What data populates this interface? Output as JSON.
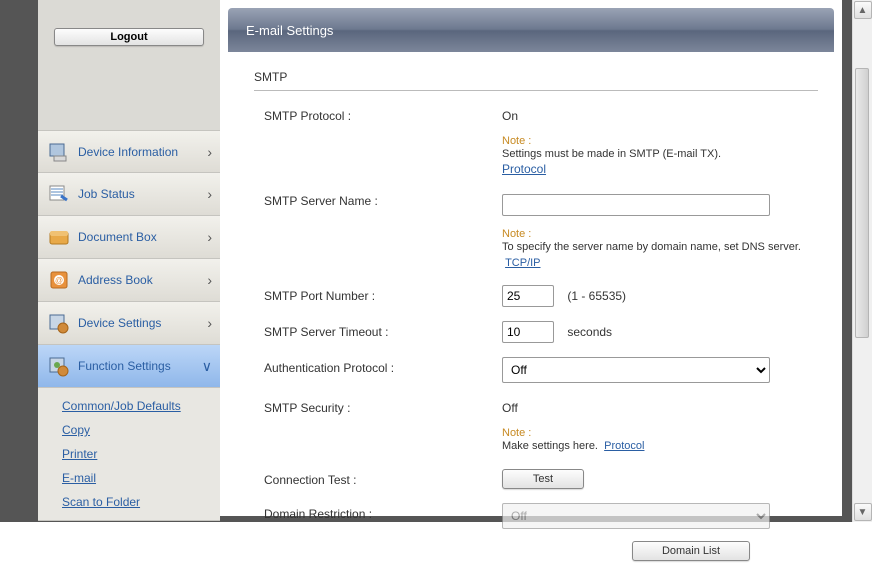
{
  "sidebar": {
    "logout_label": "Logout",
    "items": [
      {
        "label": "Device Information"
      },
      {
        "label": "Job Status"
      },
      {
        "label": "Document Box"
      },
      {
        "label": "Address Book"
      },
      {
        "label": "Device Settings"
      },
      {
        "label": "Function Settings"
      }
    ],
    "sub_items": [
      "Common/Job Defaults",
      "Copy",
      "Printer",
      "E-mail",
      "Scan to Folder"
    ]
  },
  "main": {
    "title": "E-mail Settings",
    "section": "SMTP",
    "rows": {
      "smtp_protocol_label": "SMTP Protocol :",
      "smtp_protocol_value": "On",
      "note1_title": "Note :",
      "note1_body": "Settings must be made in SMTP (E-mail TX).",
      "note1_link": "Protocol",
      "smtp_server_name_label": "SMTP Server Name :",
      "smtp_server_name_value": "",
      "note2_title": "Note :",
      "note2_body": "To specify the server name by domain name, set DNS server.",
      "note2_link": "TCP/IP",
      "smtp_port_label": "SMTP Port Number :",
      "smtp_port_value": "25",
      "smtp_port_hint": "(1 - 65535)",
      "smtp_timeout_label": "SMTP Server Timeout :",
      "smtp_timeout_value": "10",
      "smtp_timeout_unit": "seconds",
      "auth_protocol_label": "Authentication Protocol :",
      "auth_protocol_value": "Off",
      "smtp_security_label": "SMTP Security :",
      "smtp_security_value": "Off",
      "note3_title": "Note :",
      "note3_body": "Make settings here.",
      "note3_link": "Protocol",
      "conn_test_label": "Connection Test :",
      "conn_test_btn": "Test",
      "domain_restrict_label": "Domain Restriction :",
      "domain_restrict_value": "Off",
      "domain_list_btn": "Domain List"
    }
  }
}
